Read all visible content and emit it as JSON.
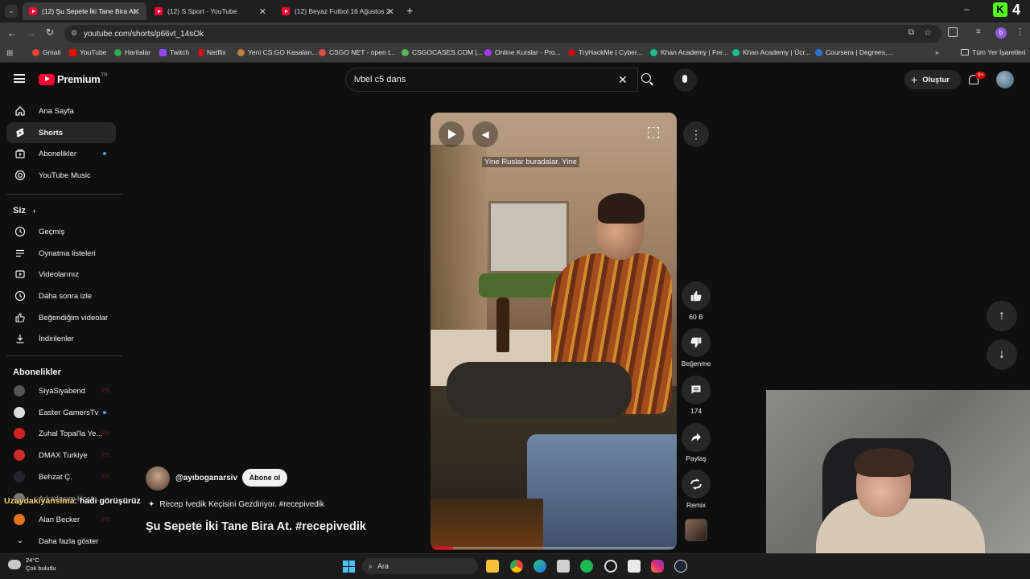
{
  "browser": {
    "tabs": [
      {
        "label": "(12) Şu Sepete İki Tane Bira At.",
        "active": true
      },
      {
        "label": "(12) S Sport - YouTube",
        "active": false
      },
      {
        "label": "(12) Beyaz Futbol 16 Ağustos 2",
        "active": false
      }
    ],
    "url": "youtube.com/shorts/p66vt_14sOk",
    "bookmarks": [
      "Gmail",
      "YouTube",
      "Haritalar",
      "Twitch",
      "Netflix",
      "Yeni CS:GO Kasaları...",
      "CSGO NET - open t...",
      "CSGOCASES.COM |...",
      "Online Kurslar - Pro...",
      "TryHackMe | Cyber...",
      "Khan Academy | Fre...",
      "Khan Academy | Ücr...",
      "Coursera | Degrees,..."
    ],
    "all_bookmarks": "Tüm Yer İşaretleri",
    "corner_badge": "4"
  },
  "youtube": {
    "logo_text": "Premium",
    "logo_sup": "TR",
    "search_value": "lvbel c5 dans",
    "create_label": "Oluştur",
    "notif_badge": "9+"
  },
  "sidebar": {
    "main": [
      "Ana Sayfa",
      "Shorts",
      "Abonelikler",
      "YouTube Music"
    ],
    "you_header": "Siz",
    "you_items": [
      "Geçmiş",
      "Oynatma listeleri",
      "Videolarınız",
      "Daha sonra izle",
      "Beğendiğim videolar",
      "İndirilenler"
    ],
    "subs_header": "Abonelikler",
    "subs": [
      "SiyaSiyabend",
      "Easter GamersTv",
      "Zuhal Topal'la Ye...",
      "DMAX Turkiye",
      "Behzat Ç.",
      "Arkadaşım Hoşt...",
      "Alan Becker"
    ],
    "show_more": "Daha fazla göster"
  },
  "short": {
    "caption_overlay": "Yine Ruslar buradalar. Yine",
    "channel": "@ayıboganarsiv",
    "subscribe_label": "Abone ol",
    "description": "Recep İvedik Keçisini Gezdiriyor. #recepivedik",
    "title": "Şu Sepete İki Tane Bira At. #recepivedik",
    "likes": "60 B",
    "dislike_label": "Beğenme",
    "comments": "174",
    "share_label": "Paylaş",
    "remix_label": "Remix"
  },
  "stream_chat": {
    "user": "Uzaydakiyansima",
    "message": ": hadi görüşürüz"
  },
  "taskbar": {
    "temp": "24°C",
    "weather": "Çok bulutlu",
    "search_label": "Ara"
  }
}
